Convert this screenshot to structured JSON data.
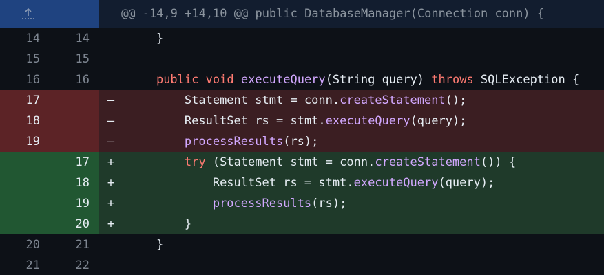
{
  "hunk": {
    "header": "@@ -14,9 +14,10 @@ public DatabaseManager(Connection conn) {",
    "expand_icon": "expand-up-icon"
  },
  "colors": {
    "deletion_bg": "#3b1e22",
    "addition_bg": "#1f3a2a",
    "keyword": "#ff7b72",
    "function": "#d2a8ff"
  },
  "lines": [
    {
      "type": "context",
      "old": "14",
      "new": "14",
      "marker": "",
      "code": "    }"
    },
    {
      "type": "context",
      "old": "15",
      "new": "15",
      "marker": "",
      "code": ""
    },
    {
      "type": "context",
      "old": "16",
      "new": "16",
      "marker": "",
      "code": "    public void executeQuery(String query) throws SQLException {"
    },
    {
      "type": "del",
      "old": "17",
      "new": "",
      "marker": "–",
      "code": "        Statement stmt = conn.createStatement();"
    },
    {
      "type": "del",
      "old": "18",
      "new": "",
      "marker": "–",
      "code": "        ResultSet rs = stmt.executeQuery(query);"
    },
    {
      "type": "del",
      "old": "19",
      "new": "",
      "marker": "–",
      "code": "        processResults(rs);"
    },
    {
      "type": "add",
      "old": "",
      "new": "17",
      "marker": "+",
      "code": "        try (Statement stmt = conn.createStatement()) {"
    },
    {
      "type": "add",
      "old": "",
      "new": "18",
      "marker": "+",
      "code": "            ResultSet rs = stmt.executeQuery(query);"
    },
    {
      "type": "add",
      "old": "",
      "new": "19",
      "marker": "+",
      "code": "            processResults(rs);"
    },
    {
      "type": "add",
      "old": "",
      "new": "20",
      "marker": "+",
      "code": "        }"
    },
    {
      "type": "context",
      "old": "20",
      "new": "21",
      "marker": "",
      "code": "    }"
    },
    {
      "type": "context",
      "old": "21",
      "new": "22",
      "marker": "",
      "code": ""
    }
  ]
}
